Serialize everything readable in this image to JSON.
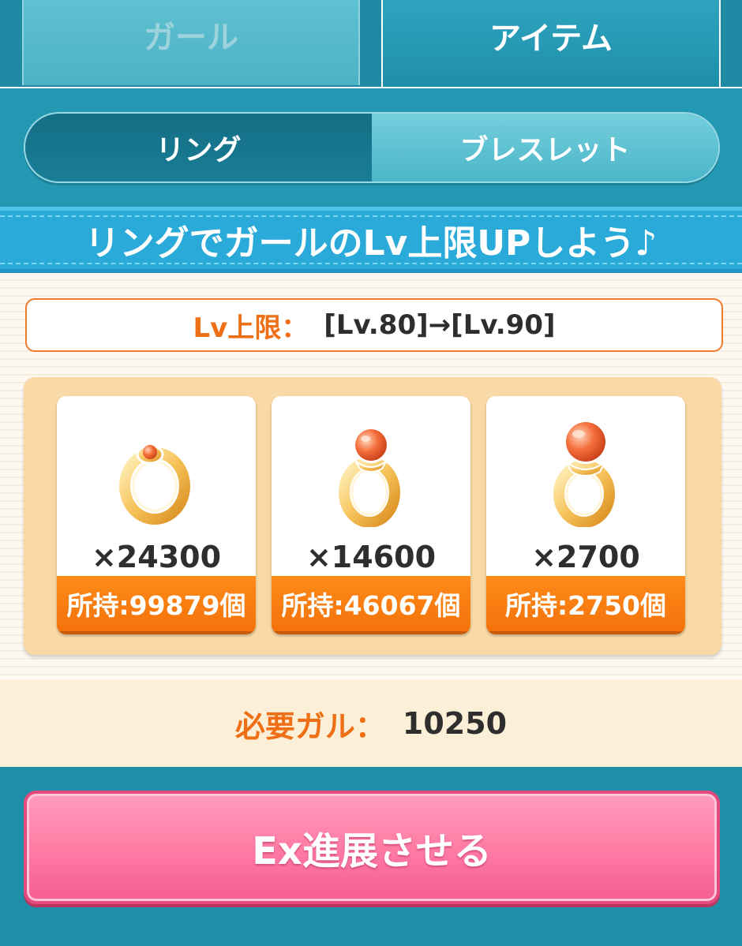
{
  "top_tabs": [
    {
      "label": "ガール",
      "active": false
    },
    {
      "label": "アイテム",
      "active": true
    }
  ],
  "sub_tabs": [
    {
      "label": "リング",
      "active": true
    },
    {
      "label": "ブレスレット",
      "active": false
    }
  ],
  "banner": {
    "text": "リングでガールのLv上限UPしよう♪"
  },
  "level_cap": {
    "label": "Lv上限：",
    "value": "[Lv.80]→[Lv.90]"
  },
  "rings": [
    {
      "icon": "small-ring-icon",
      "quantity": "×24300",
      "owned": "所持:99879個"
    },
    {
      "icon": "medium-ring-icon",
      "quantity": "×14600",
      "owned": "所持:46067個"
    },
    {
      "icon": "large-ring-icon",
      "quantity": "×2700",
      "owned": "所持:2750個"
    }
  ],
  "cost": {
    "label": "必要ガル：",
    "value": "10250"
  },
  "action": {
    "label": "Ex進展させる"
  },
  "colors": {
    "teal_bg": "#1f8fa9",
    "banner_blue": "#2aaad8",
    "orange": "#f3730a",
    "pink": "#ff7fa7"
  }
}
